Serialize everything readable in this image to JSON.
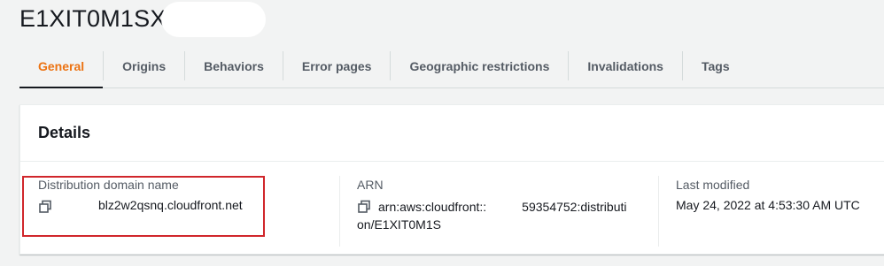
{
  "header": {
    "title": "E1XIT0M1SX"
  },
  "tabs": [
    {
      "label": "General"
    },
    {
      "label": "Origins"
    },
    {
      "label": "Behaviors"
    },
    {
      "label": "Error pages"
    },
    {
      "label": "Geographic restrictions"
    },
    {
      "label": "Invalidations"
    },
    {
      "label": "Tags"
    }
  ],
  "details": {
    "heading": "Details",
    "domain": {
      "label": "Distribution domain name",
      "value": "blz2w2qsnq.cloudfront.net"
    },
    "arn": {
      "label": "ARN",
      "value_line1": "arn:aws:cloudfront::",
      "value_line1b": "59354752:distributi",
      "value_line2": "on/E1XIT0M1S"
    },
    "last_modified": {
      "label": "Last modified",
      "value": "May 24, 2022 at 4:53:30 AM UTC"
    }
  },
  "icons": {
    "copy": "copy-icon"
  },
  "colors": {
    "accent": "#ec7211",
    "highlight": "#d0262b"
  }
}
